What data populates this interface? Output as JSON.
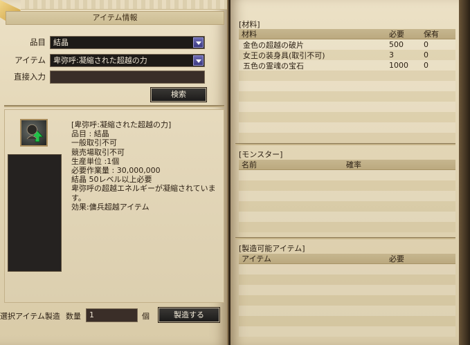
{
  "left": {
    "title": "アイテム情報",
    "form": {
      "category_label": "品目",
      "category_value": "結晶",
      "item_label": "アイテム",
      "item_value": "卑弥呼:凝縮された超越の力",
      "direct_label": "直接入力",
      "direct_value": "",
      "search_button": "検索"
    },
    "item": {
      "icon": "crystal-upgrade-icon",
      "lines": [
        "[卑弥呼:凝縮された超越の力]",
        "品目 : 結晶",
        "一般取引不可",
        "競売場取引不可",
        "",
        "生産単位 :1個",
        "必要作業量 : 30,000,000",
        "結晶 50レベル以上必要",
        "卑弥呼の超越エネルギーが凝縮されていま",
        "す。",
        "",
        "効果:傭兵超越アイテム"
      ]
    },
    "footer": {
      "craft_label": "選択アイテム製造",
      "qty_label": "数量",
      "qty_value": "1",
      "unit": "個",
      "craft_button": "製造する"
    }
  },
  "right": {
    "materials": {
      "title": "[材料]",
      "headers": [
        "材料",
        "必要",
        "保有"
      ],
      "rows": [
        [
          "金色の超越の破片",
          "500",
          "0"
        ],
        [
          "女王の装身具(取引不可)",
          "3",
          "0"
        ],
        [
          "五色の霊魂の宝石",
          "1000",
          "0"
        ]
      ]
    },
    "monster": {
      "title": "[モンスター]",
      "headers": [
        "名前",
        "確率"
      ]
    },
    "craftable": {
      "title": "[製造可能アイテム]",
      "headers": [
        "アイテム",
        "必要"
      ]
    }
  },
  "colors": {
    "accent": "#3c3a82",
    "panel": "#e3d6b6",
    "dark": "#1d1a17"
  }
}
